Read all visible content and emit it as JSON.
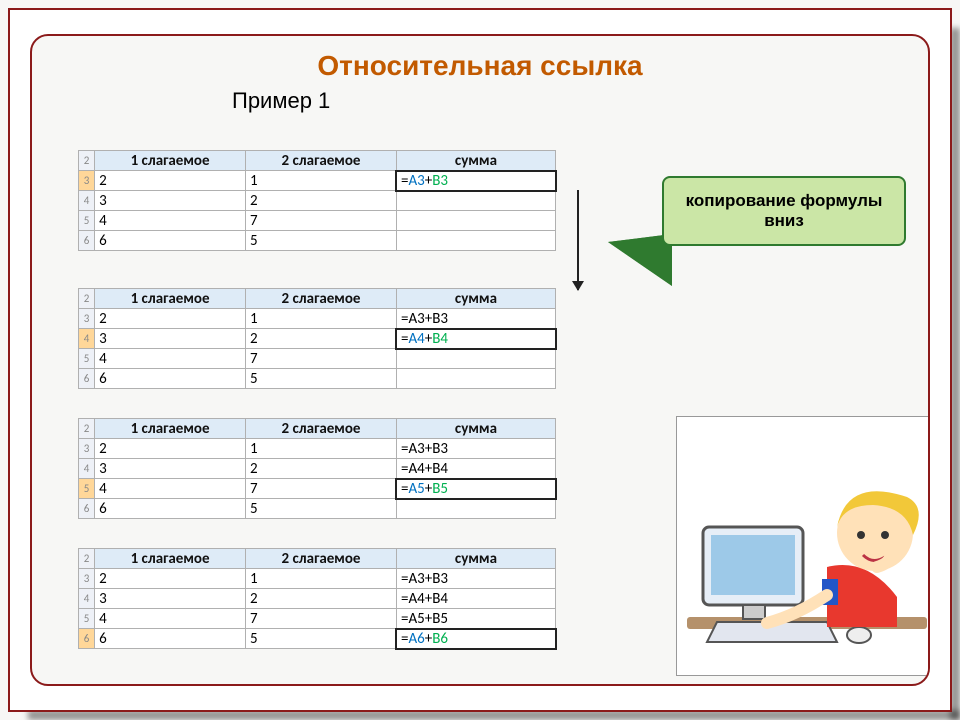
{
  "title": "Относительная ссылка",
  "subtitle": "Пример 1",
  "callout": "копирование формулы вниз",
  "headers": {
    "a": "1 слагаемое",
    "b": "2 слагаемое",
    "c": "сумма"
  },
  "rows": {
    "r2": "2",
    "r3": "3",
    "r4": "4",
    "r5": "5",
    "r6": "6"
  },
  "data": {
    "a3": "2",
    "b3": "1",
    "a4": "3",
    "b4": "2",
    "a5": "4",
    "b5": "7",
    "a6": "6",
    "b6": "5"
  },
  "formulas": {
    "eq": "=",
    "p": "+",
    "A3": "A3",
    "B3": "B3",
    "A4": "A4",
    "B4": "B4",
    "A5": "A5",
    "B5": "B5",
    "A6": "A6",
    "B6": "B6",
    "c3_plain": "=A3+B3",
    "c4_plain": "=A4+B4",
    "c5_plain": "=A5+B5"
  }
}
